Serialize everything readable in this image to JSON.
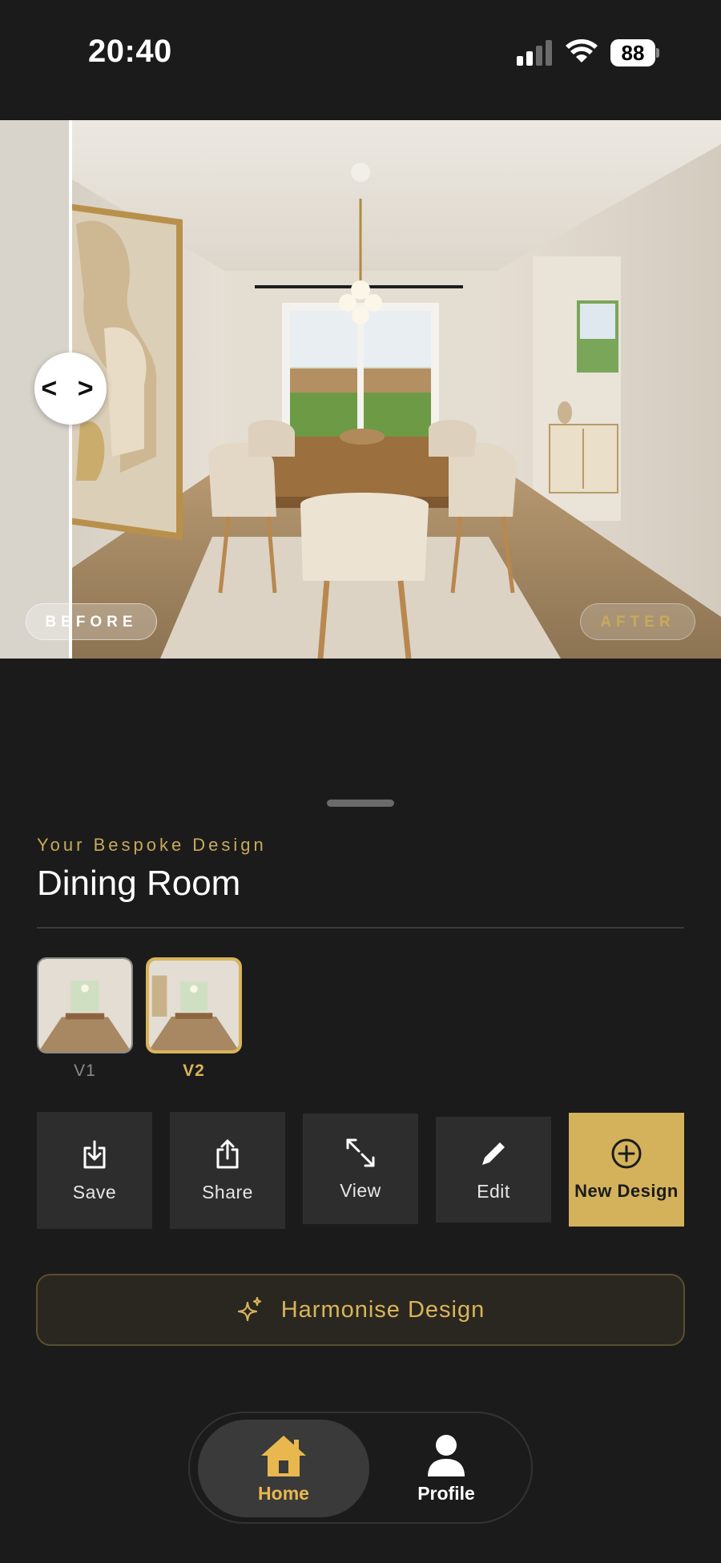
{
  "status_bar": {
    "time": "20:40",
    "battery": "88"
  },
  "hero": {
    "before_label": "BEFORE",
    "after_label": "AFTER",
    "handle_glyph": "< >"
  },
  "design": {
    "subtitle": "Your Bespoke Design",
    "title": "Dining Room",
    "versions": [
      {
        "label": "V1",
        "selected": false
      },
      {
        "label": "V2",
        "selected": true
      }
    ]
  },
  "actions": [
    {
      "label": "Save",
      "icon": "download-icon"
    },
    {
      "label": "Share",
      "icon": "share-icon"
    },
    {
      "label": "View",
      "icon": "expand-icon"
    },
    {
      "label": "Edit",
      "icon": "pencil-icon"
    },
    {
      "label": "New Design",
      "icon": "plus-circle-icon"
    }
  ],
  "harmonise": {
    "label": "Harmonise Design",
    "icon": "sparkle-icon"
  },
  "nav": {
    "home_label": "Home",
    "profile_label": "Profile"
  },
  "colors": {
    "background": "#1b1b1b",
    "accent_gold": "#d4b25c",
    "card": "#2d2d2d"
  }
}
